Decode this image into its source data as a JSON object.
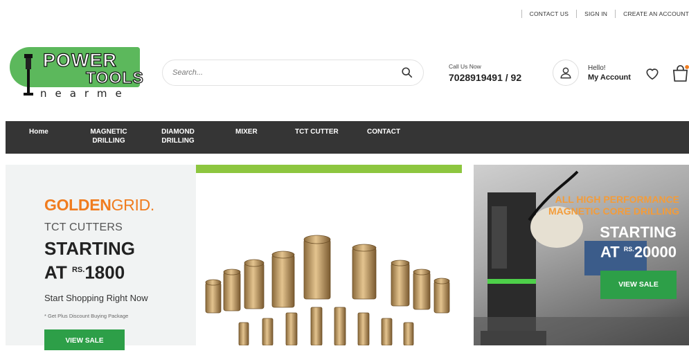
{
  "toplinks": {
    "contact": "CONTACT US",
    "signin": "SIGN IN",
    "create": "CREATE AN ACCOUNT"
  },
  "logo": {
    "line1": "POWER",
    "line2": "TOOLS",
    "line3": "nearme"
  },
  "search": {
    "placeholder": "Search..."
  },
  "call": {
    "label": "Call Us Now",
    "number": "7028919491 / 92"
  },
  "account": {
    "hello": "Hello!",
    "my_account": "My Account"
  },
  "nav": [
    {
      "label": "Home"
    },
    {
      "label": "MAGNETIC DRILLING"
    },
    {
      "label": "DIAMOND DRILLING"
    },
    {
      "label": "MIXER"
    },
    {
      "label": "TCT CUTTER"
    },
    {
      "label": "CONTACT"
    }
  ],
  "banner_left": {
    "brand_bold": "GOLDEN",
    "brand_light": "GRID.",
    "subtitle": "TCT CUTTERS",
    "starting": "STARTING",
    "at": "AT",
    "currency": "RS.",
    "price": "1800",
    "cta_text": "Start Shopping Right Now",
    "note": "* Get Plus Discount Buying Package",
    "button": "VIEW SALE"
  },
  "banner_right": {
    "headline1": "ALL HIGH PERFORMANCE",
    "headline2": "MAGNETIC CORE DRILLING",
    "starting": "STARTING",
    "at": "AT",
    "currency": "RS.",
    "price": "20000",
    "button": "VIEW SALE"
  },
  "colors": {
    "green": "#5cb85c",
    "nav_bg": "#353535",
    "orange": "#f07c1f",
    "button_green": "#2d9f48",
    "lime_bar": "#8dc63f"
  }
}
